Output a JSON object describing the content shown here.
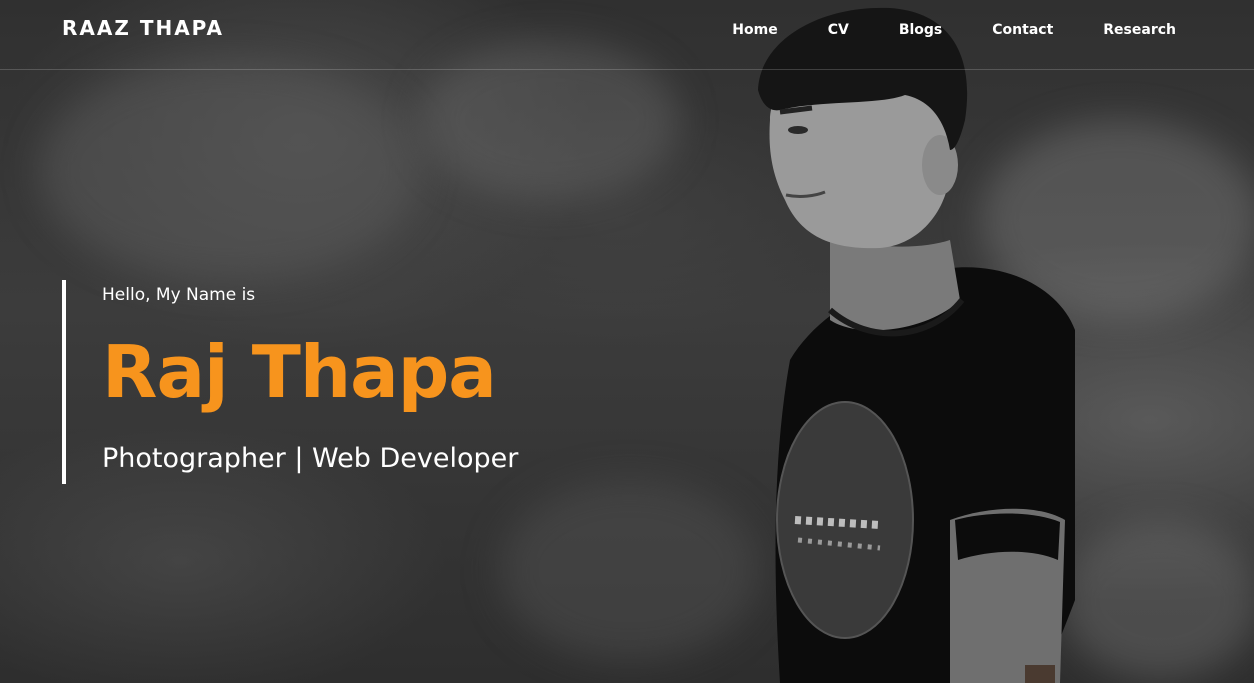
{
  "brand": {
    "name": "RAAZ THAPA"
  },
  "nav": {
    "items": [
      {
        "label": "Home"
      },
      {
        "label": "CV"
      },
      {
        "label": "Blogs"
      },
      {
        "label": "Contact"
      },
      {
        "label": "Research"
      }
    ]
  },
  "hero": {
    "greeting": "Hello, My Name is",
    "name": "Raj Thapa",
    "roles": "Photographer | Web Developer",
    "accent_color": "#f7941d"
  },
  "icons": {
    "photo": "portrait-photo"
  }
}
